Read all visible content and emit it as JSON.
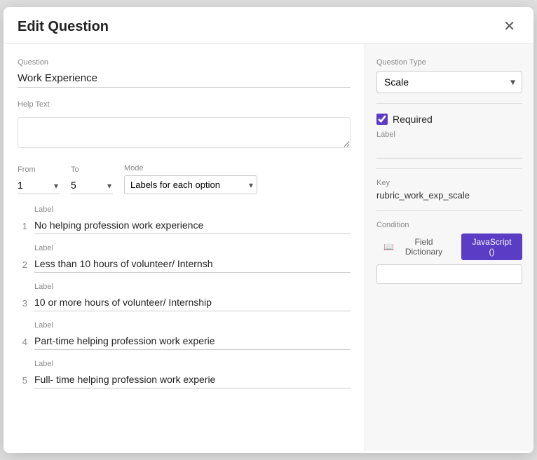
{
  "modal": {
    "title": "Edit Question",
    "close_icon": "✕"
  },
  "left": {
    "question_label": "Question",
    "question_value": "Work Experience",
    "help_text_label": "Help Text",
    "help_text_placeholder": "",
    "scale": {
      "from_label": "From",
      "from_value": "1",
      "to_label": "To",
      "to_value": "5",
      "mode_label": "Mode",
      "mode_value": "Labels for each option"
    },
    "options": [
      {
        "num": "1",
        "label_text": "Label",
        "value": "No helping profession work experience"
      },
      {
        "num": "2",
        "label_text": "Label",
        "value": "Less than 10 hours of volunteer/ Internsh"
      },
      {
        "num": "3",
        "label_text": "Label",
        "value": "10 or more hours of volunteer/ Internship"
      },
      {
        "num": "4",
        "label_text": "Label",
        "value": "Part-time helping profession work experie"
      },
      {
        "num": "5",
        "label_text": "Label",
        "value": "Full- time helping profession work experie"
      }
    ]
  },
  "right": {
    "question_type_label": "Question Type",
    "question_type_value": "Scale",
    "required_label": "Required",
    "label_section_label": "Label",
    "label_value": "",
    "key_label": "Key",
    "key_value": "rubric_work_exp_scale",
    "condition_label": "Condition",
    "tab_field_dictionary": "Field Dictionary",
    "tab_javascript": "JavaScript ()",
    "condition_input_value": ""
  }
}
